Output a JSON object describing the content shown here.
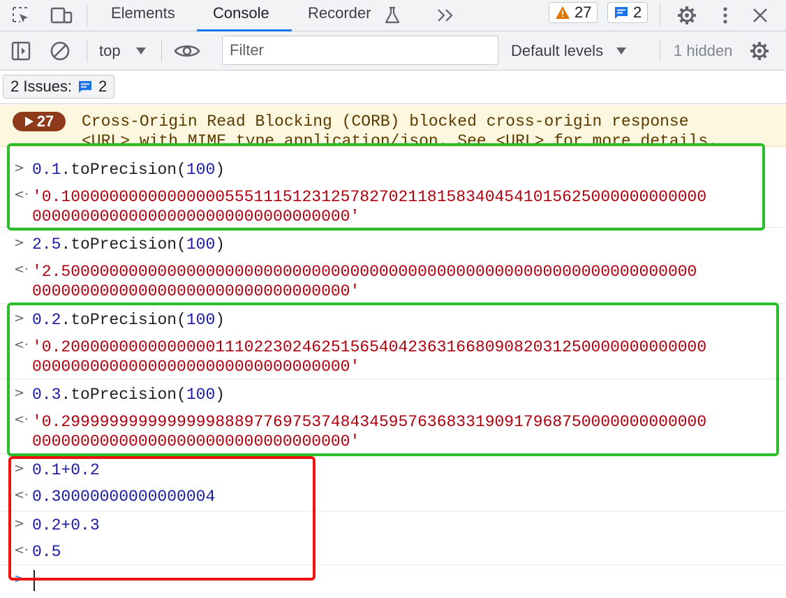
{
  "tabs": {
    "elements": "Elements",
    "console": "Console",
    "recorder": "Recorder"
  },
  "badges": {
    "warnings": "27",
    "messages": "2"
  },
  "toolbar": {
    "context": "top",
    "filter_placeholder": "Filter",
    "levels": "Default levels",
    "hidden": "1 hidden"
  },
  "issues": {
    "label": "2 Issues:",
    "count": "2"
  },
  "warning": {
    "count": "27",
    "line1": "Cross-Origin Read Blocking (CORB) blocked cross-origin response",
    "line2": "<URL> with MIME type application/json. See <URL> for more details."
  },
  "entries": [
    {
      "num": "0.1",
      "call": ".toPrecision(",
      "arg": "100",
      "close": ")",
      "out1": "'0.1000000000000000055511151231257827021181583404541015625000000000000",
      "out2": "000000000000000000000000000000000'"
    },
    {
      "num": "2.5",
      "call": ".toPrecision(",
      "arg": "100",
      "close": ")",
      "out1": "'2.500000000000000000000000000000000000000000000000000000000000000000",
      "out2": "000000000000000000000000000000000'"
    },
    {
      "num": "0.2",
      "call": ".toPrecision(",
      "arg": "100",
      "close": ")",
      "out1": "'0.2000000000000000111022302462515654042363166809082031250000000000000",
      "out2": "000000000000000000000000000000000'"
    },
    {
      "num": "0.3",
      "call": ".toPrecision(",
      "arg": "100",
      "close": ")",
      "out1": "'0.2999999999999999888977697537484345957636833190917968750000000000000",
      "out2": "000000000000000000000000000000000'"
    }
  ],
  "sums": [
    {
      "input": "0.1+0.2",
      "output": "0.30000000000000004"
    },
    {
      "input": "0.2+0.3",
      "output": "0.5"
    }
  ],
  "colors": {
    "accent": "#1a73e8",
    "highlight_green": "#2cbd2c",
    "highlight_red": "#ee1111"
  }
}
